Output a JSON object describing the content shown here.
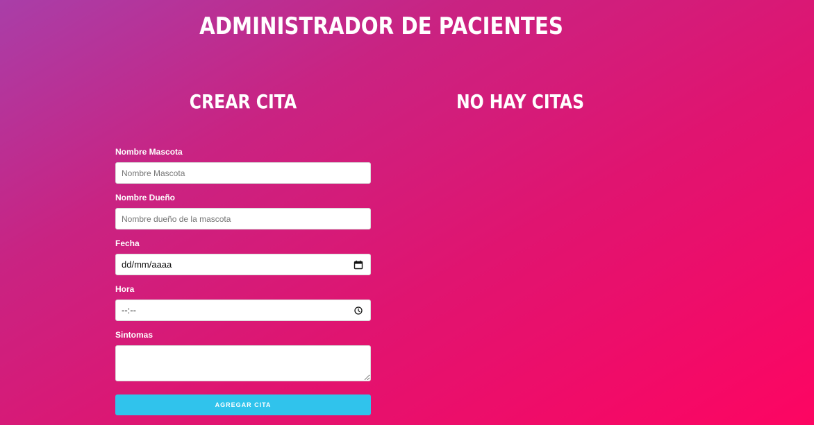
{
  "header": {
    "title": "ADMINISTRADOR DE PACIENTES"
  },
  "form": {
    "title": "CREAR CITA",
    "fields": {
      "pet_name": {
        "label": "Nombre Mascota",
        "placeholder": "Nombre Mascota",
        "value": ""
      },
      "owner_name": {
        "label": "Nombre Dueño",
        "placeholder": "Nombre dueño de la mascota",
        "value": ""
      },
      "date": {
        "label": "Fecha",
        "value": "dd/mm/aaaa",
        "icon": "calendar-icon"
      },
      "time": {
        "label": "Hora",
        "value": "--:--",
        "icon": "clock-icon"
      },
      "symptoms": {
        "label": "Sintomas",
        "value": ""
      }
    },
    "submit_label": "AGREGAR CITA"
  },
  "appointments": {
    "title": "NO HAY CITAS"
  },
  "colors": {
    "background_start": "#a93ea8",
    "background_end": "#fd0562",
    "button": "#30c3ec",
    "text": "#ffffff"
  }
}
